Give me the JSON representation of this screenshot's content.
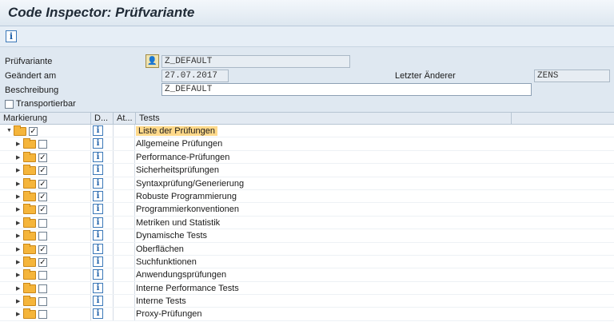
{
  "title": "Code Inspector: Prüfvariante",
  "toolbar": {
    "info_icon": "info-icon"
  },
  "form": {
    "variant_label": "Prüfvariante",
    "variant_value": "Z_DEFAULT",
    "changed_label": "Geändert am",
    "changed_value": "27.07.2017",
    "last_changer_label": "Letzter Änderer",
    "last_changer_value": "ZENS",
    "description_label": "Beschreibung",
    "description_value": "Z_DEFAULT",
    "transport_label": "Transportierbar",
    "transport_checked": false
  },
  "grid": {
    "headers": [
      "Markierung",
      "D...",
      "At...",
      "Tests"
    ],
    "rows": [
      {
        "name": "Liste der Prüfungen",
        "checked": true,
        "level": 0,
        "expanded": true
      },
      {
        "name": "Allgemeine Prüfungen",
        "checked": false,
        "level": 1
      },
      {
        "name": "Performance-Prüfungen",
        "checked": true,
        "level": 1
      },
      {
        "name": "Sicherheitsprüfungen",
        "checked": true,
        "level": 1
      },
      {
        "name": "Syntaxprüfung/Generierung",
        "checked": true,
        "level": 1
      },
      {
        "name": "Robuste Programmierung",
        "checked": true,
        "level": 1
      },
      {
        "name": "Programmierkonventionen",
        "checked": true,
        "level": 1
      },
      {
        "name": "Metriken und Statistik",
        "checked": false,
        "level": 1
      },
      {
        "name": "Dynamische Tests",
        "checked": false,
        "level": 1
      },
      {
        "name": "Oberflächen",
        "checked": true,
        "level": 1
      },
      {
        "name": "Suchfunktionen",
        "checked": true,
        "level": 1
      },
      {
        "name": "Anwendungsprüfungen",
        "checked": false,
        "level": 1
      },
      {
        "name": "Interne Performance Tests",
        "checked": false,
        "level": 1
      },
      {
        "name": "Interne Tests",
        "checked": false,
        "level": 1
      },
      {
        "name": "Proxy-Prüfungen",
        "checked": false,
        "level": 1
      }
    ]
  }
}
